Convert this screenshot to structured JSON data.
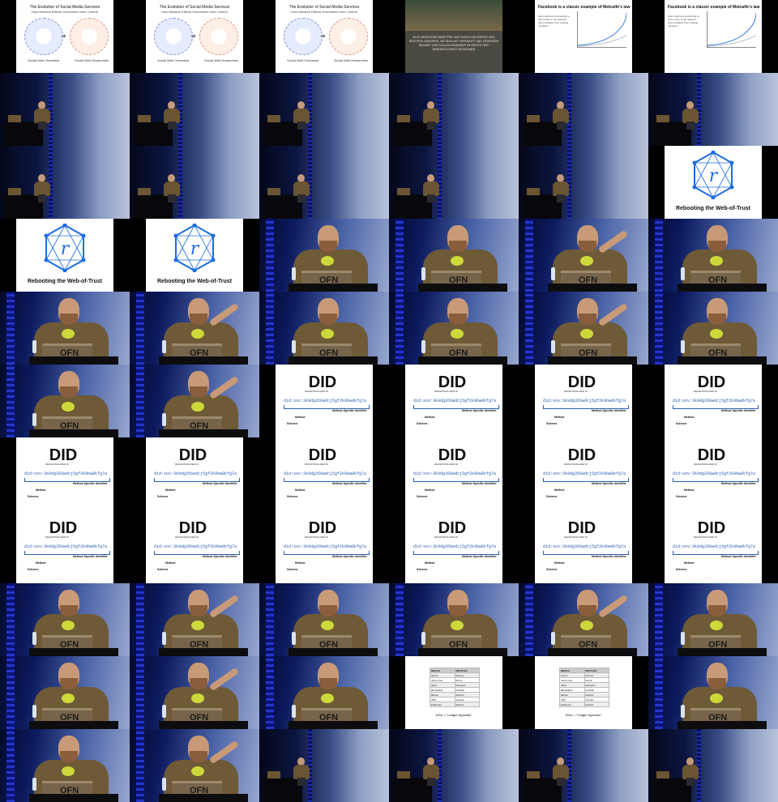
{
  "title": "",
  "slides": {
    "evolution": {
      "title": "The Evolution of Social Media Services",
      "subtitle": "How Network Effects Overwhelm User Control",
      "left_caption": "Social Web Cheesiest",
      "right_caption": "Social Web Monarchies"
    },
    "hall": {
      "text": "ALLE MENSCHEN SIND FREI UND GLEICH AN WÜRDE UND RECHTEN GEBOREN. SIE SIND MIT VERNUNFT UND GEWISSEN BEGABT UND SOLLEN EINANDER IM GEISTE DER BRÜDERLICHKEIT BEGEGNEN"
    },
    "facebook": {
      "title": "Facebook is a classic example of Metcalfe's law",
      "body": "Users add new connecting to other users in the network upon invitation from existing members"
    },
    "rwot": {
      "glyph": "r",
      "caption": "Rebooting the Web-of-Trust"
    },
    "did": {
      "logo": "DID",
      "logo_sub": "DECENTRALIZED ID",
      "identifier": "did:sov:3k9dg356wdcj5gf2k9bw8kfg7a",
      "msi_label": "Method-Specific Identifier",
      "method_label": "Method",
      "scheme_label": "Scheme"
    },
    "ledger": {
      "headers": [
        "Method",
        "DID Prefix"
      ],
      "rows": [
        [
          "Sovrin",
          "did:sov:"
        ],
        [
          "Veres One",
          "did:v1:"
        ],
        [
          "uPort",
          "did:uport:"
        ],
        [
          "Blockstack",
          "did:btck:"
        ],
        [
          "Bitcoin",
          "did:btcr:"
        ],
        [
          "IPID",
          "did:ipid:"
        ],
        [
          "Ethereum",
          "did:eth:"
        ]
      ],
      "caption": "DIDs = \"Ledger Agnostic\""
    },
    "laptop_label": "OFN"
  },
  "grid": {
    "columns": 6,
    "rows": 11,
    "cells": [
      "evo",
      "evo",
      "evo",
      "hall",
      "fb",
      "fb",
      "stage",
      "stage",
      "stage",
      "stage",
      "stage",
      "stage",
      "stage",
      "stage",
      "stage",
      "stage",
      "stage",
      "rwot",
      "rwot",
      "rwot",
      "close",
      "close",
      "close",
      "close",
      "close",
      "close",
      "close",
      "close",
      "close",
      "close",
      "close",
      "close",
      "did",
      "did",
      "did",
      "did",
      "did",
      "did",
      "did",
      "did",
      "did",
      "did",
      "did",
      "did",
      "did",
      "did",
      "did",
      "did",
      "close",
      "close",
      "close",
      "close",
      "close",
      "close",
      "close",
      "close",
      "close",
      "ledger",
      "ledger",
      "close",
      "close",
      "close",
      "stage",
      "stage",
      "stage",
      "stage"
    ]
  }
}
